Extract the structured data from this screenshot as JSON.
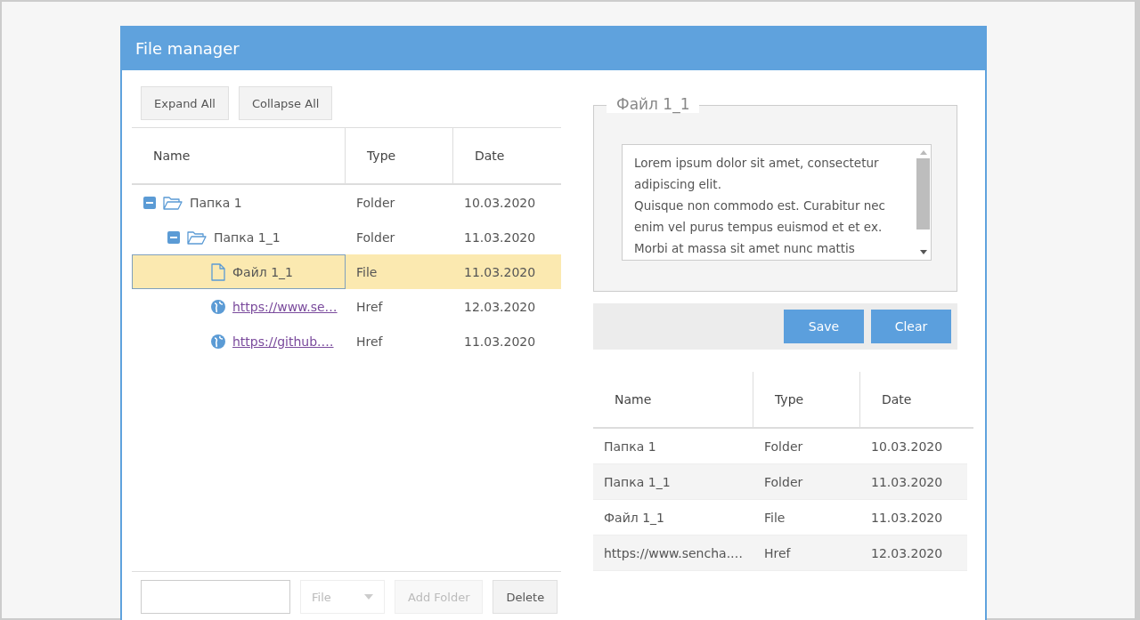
{
  "window": {
    "title": "File manager"
  },
  "tree_toolbar": {
    "buttons": [
      {
        "label": "Expand All"
      },
      {
        "label": "Collapse All"
      }
    ]
  },
  "tree": {
    "columns": [
      "Name",
      "Type",
      "Date"
    ],
    "rows": [
      {
        "kind": "folder",
        "name": "Папка 1",
        "type": "Folder",
        "date": "10.03.2020",
        "expanded": true,
        "selected": false,
        "children": [
          {
            "kind": "folder",
            "name": "Папка 1_1",
            "type": "Folder",
            "date": "11.03.2020",
            "expanded": true,
            "selected": false,
            "children": [
              {
                "kind": "file",
                "name": "Файл 1_1",
                "type": "File",
                "date": "11.03.2020",
                "selected": true
              },
              {
                "kind": "link",
                "name": "https://www.se…",
                "type": "Href",
                "date": "12.03.2020",
                "selected": false
              },
              {
                "kind": "link",
                "name": "https://github.…",
                "type": "Href",
                "date": "11.03.2020",
                "selected": false
              }
            ]
          }
        ]
      }
    ]
  },
  "bottom_toolbar": {
    "name_field": {
      "disabled": false
    },
    "type_combo": {
      "value": "File",
      "disabled": true
    },
    "buttons": [
      {
        "label": "Add Folder",
        "disabled": true
      },
      {
        "label": "Delete",
        "disabled": false
      }
    ]
  },
  "details": {
    "legend": "Файл 1_1",
    "text": "Lorem ipsum dolor sit amet, consectetur adipiscing elit.\nQuisque non commodo est. Curabitur nec enim vel purus tempus euismod et et ex.\nMorbi at massa sit amet nunc mattis",
    "buttons": [
      {
        "label": "Save"
      },
      {
        "label": "Clear"
      }
    ]
  },
  "list": {
    "columns": [
      "Name",
      "Type",
      "Date"
    ],
    "rows": [
      {
        "name": "Папка 1",
        "type": "Folder",
        "date": "10.03.2020"
      },
      {
        "name": "Папка 1_1",
        "type": "Folder",
        "date": "11.03.2020"
      },
      {
        "name": "Файл 1_1",
        "type": "File",
        "date": "11.03.2020"
      },
      {
        "name": "https://www.sencha.…",
        "type": "Href",
        "date": "12.03.2020"
      }
    ]
  }
}
